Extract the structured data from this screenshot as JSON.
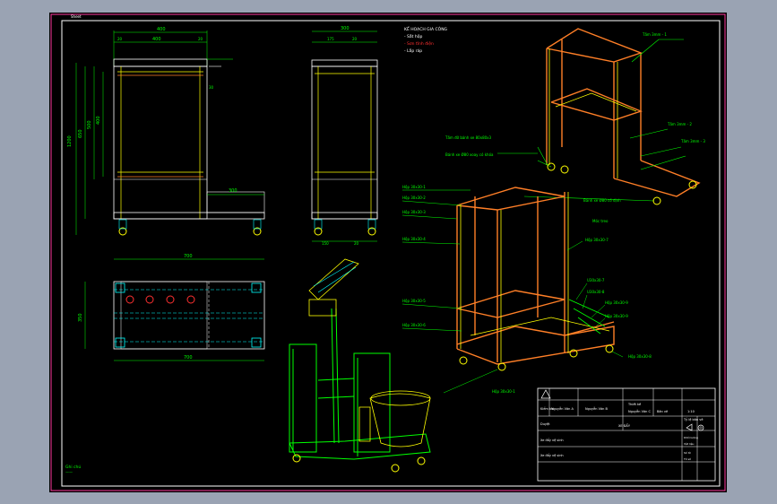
{
  "sheet_tag": "Sheet",
  "notes": {
    "title": "KẾ HOẠCH GIA CÔNG",
    "line1": "- Sắt hộp",
    "line2": "- Sơn tĩnh điện",
    "line3": "- Lắp ráp"
  },
  "dims": {
    "front_top": "400",
    "front_top2": "400",
    "front_small": "20",
    "front_small2": "20",
    "front_right": "30",
    "front_side1": "400",
    "front_side2": "1200",
    "front_side3": "650",
    "front_side4": "500",
    "front_ext": "300",
    "front_bottom": "700",
    "side_top": "300",
    "side_top_a": "175",
    "side_top_b": "20",
    "side_bottom_a": "150",
    "side_bottom_b": "20",
    "plan_left": "350",
    "plan_bottom": "700"
  },
  "callouts_top": {
    "c1": "Tấm 3mm - 1",
    "c2": "Tấm 3mm - 2",
    "c3": "Tấm 3mm - 3",
    "c4": "Tấm đỡ bánh xe 80x80x3",
    "c5": "Bánh xe Ø80 xoay có khóa",
    "c6": "Bánh xe Ø80 cố định",
    "c7": "Móc treo"
  },
  "callouts_bottom": {
    "l1": "Hộp 30x30-1",
    "l2": "Hộp 30x30-2",
    "l3": "Hộp 30x30-3",
    "l4": "Hộp 30x30-4",
    "l5": "Hộp 30x30-5",
    "l6": "Hộp 30x30-6",
    "l7": "Hộp 30x30-7",
    "r1": "Hộp 30x30-7",
    "r2": "U30x30-7",
    "r3": "U30x30-8",
    "r4": "Hộp 30x30-9",
    "r5": "Hộp 30x30-9",
    "r6": "Hộp 30x30-8",
    "b1": "Hộp 30x30-1"
  },
  "bottom_left_note": "Ghi chú",
  "bottom_left_note2": "——",
  "title_block": {
    "r1c1": "Kiểm tra",
    "r1c2": "Nguyễn Văn A",
    "r1c3": "Nguyễn Văn B",
    "r1c4": "Thiết kế",
    "r1c5": "Nguyễn Văn C",
    "r1c6": "Bản vẽ",
    "r1c7": "1:10",
    "r2c1": "Duyệt",
    "r2c2": "XE ĐẨY",
    "scale_label": "Tỷ lệ bản vẽ",
    "r3c1": "Xe đẩy vệ sinh",
    "r4c1": "Xe đẩy vệ sinh",
    "m1": "Khối lượng",
    "m2": "Vật liệu",
    "m3": "Số tờ",
    "m4": "Tờ số"
  },
  "colors": {
    "frame": "#ffffff",
    "line": "#00ff00",
    "yellow": "#ffff00",
    "orange": "#ff7f27",
    "cyan": "#00ffff",
    "text": "#00ff00"
  }
}
